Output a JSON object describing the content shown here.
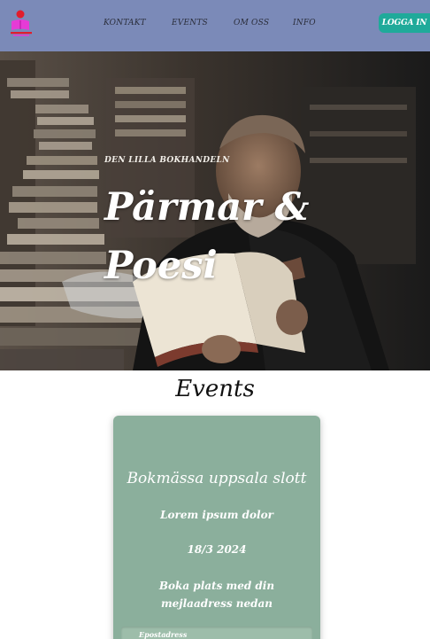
{
  "header": {
    "nav": [
      "KONTAKT",
      "EVENTS",
      "OM OSS",
      "INFO"
    ],
    "login_label": "LOGGA IN",
    "colors": {
      "bar": "#7b8ab8",
      "login": "#1faa9a"
    }
  },
  "hero": {
    "kicker": "DEN LILLA BOKHANDELN",
    "title": "Pärmar & Poesi"
  },
  "events": {
    "heading": "Events",
    "card": {
      "title": "Bokmässa uppsala slott",
      "subtitle": "Lorem ipsum dolor",
      "date": "18/3 2024",
      "cta": "Boka plats med din mejlaadress nedan",
      "email_label": "Epostadress",
      "color": "#8baf9c"
    }
  }
}
